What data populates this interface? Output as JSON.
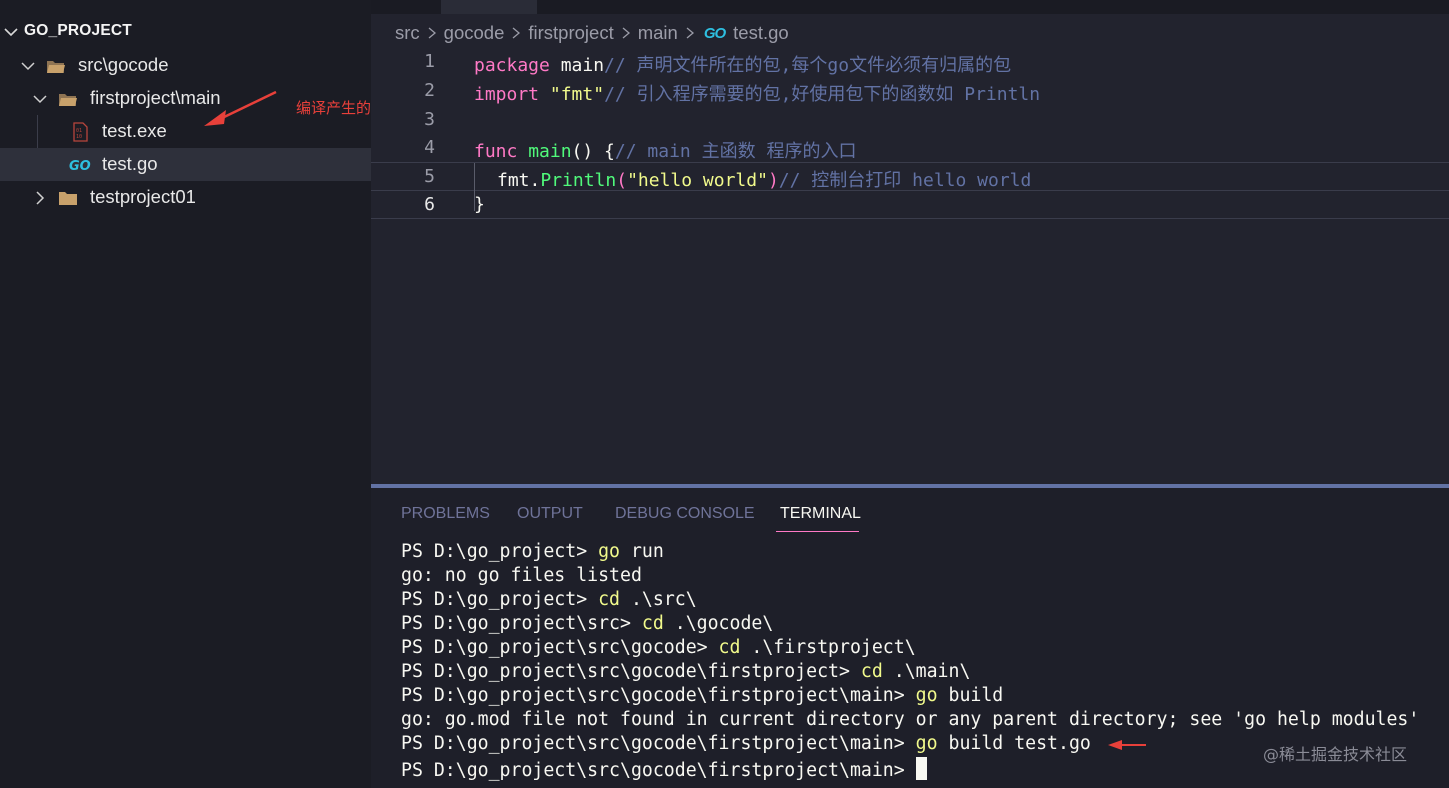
{
  "sidebar": {
    "title": "GO_PROJECT",
    "items": [
      {
        "label": "src\\gocode"
      },
      {
        "label": "firstproject\\main"
      },
      {
        "label": "test.exe"
      },
      {
        "label": "test.go"
      },
      {
        "label": "testproject01"
      }
    ],
    "annotation": "编译产生的文件"
  },
  "breadcrumb": {
    "parts": [
      "src",
      "gocode",
      "firstproject",
      "main",
      "test.go"
    ],
    "go_icon_text": "GO"
  },
  "editor": {
    "line_numbers": [
      "1",
      "2",
      "3",
      "4",
      "5",
      "6"
    ],
    "lines": [
      {
        "t1": "package",
        "t2": " main",
        "t3": "// 声明文件所在的包,每个go文件必须有归属的包"
      },
      {
        "t1": "import",
        "t2": " \"fmt\"",
        "t3": "// 引入程序需要的包,好使用包下的函数如 Println"
      },
      {},
      {
        "t1": "func",
        "t2": " main",
        "t3": "() {",
        "t4": "// main 主函数 程序的入口"
      },
      {
        "t1": "fmt.",
        "t2": "Println",
        "t3": "(",
        "t4": "\"hello world\"",
        "t5": ")",
        "t6": "// 控制台打印 hello world"
      },
      {
        "t1": "}"
      }
    ]
  },
  "panel": {
    "tabs": [
      "PROBLEMS",
      "OUTPUT",
      "DEBUG CONSOLE",
      "TERMINAL"
    ],
    "terminal": [
      {
        "p": "PS D:\\go_project> ",
        "c": "go",
        "r": " run"
      },
      {
        "p": "go: no go files listed",
        "c": "",
        "r": ""
      },
      {
        "p": "PS D:\\go_project> ",
        "c": "cd",
        "r": " .\\src\\"
      },
      {
        "p": "PS D:\\go_project\\src> ",
        "c": "cd",
        "r": " .\\gocode\\"
      },
      {
        "p": "PS D:\\go_project\\src\\gocode> ",
        "c": "cd",
        "r": " .\\firstproject\\"
      },
      {
        "p": "PS D:\\go_project\\src\\gocode\\firstproject> ",
        "c": "cd",
        "r": " .\\main\\"
      },
      {
        "p": "PS D:\\go_project\\src\\gocode\\firstproject\\main> ",
        "c": "go",
        "r": " build"
      },
      {
        "p": "go: go.mod file not found in current directory or any parent directory; see 'go help modules'",
        "c": "",
        "r": ""
      },
      {
        "p": "PS D:\\go_project\\src\\gocode\\firstproject\\main> ",
        "c": "go",
        "r": " build test.go"
      },
      {
        "p": "PS D:\\go_project\\src\\gocode\\firstproject\\main> ",
        "c": "",
        "r": ""
      }
    ],
    "watermark": "@稀土掘金技术社区"
  },
  "colors": {
    "keyword": "#ff79c6",
    "function": "#50fa7b",
    "string": "#f1fa8c",
    "comment": "#6272a4",
    "go_icon": "#2ebfe0",
    "folder": "#c8a16b",
    "annotation": "#e8403a"
  }
}
